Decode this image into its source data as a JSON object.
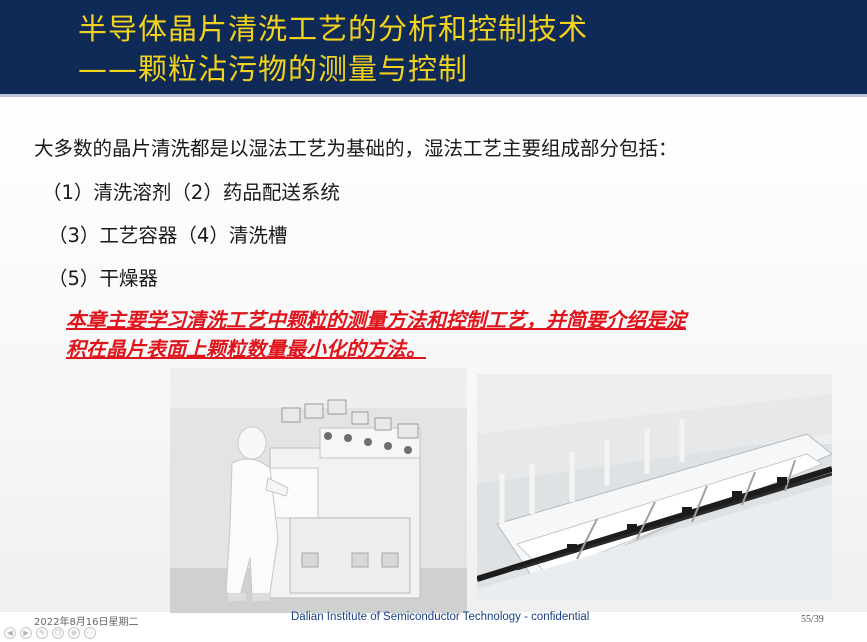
{
  "slide": {
    "title_line1": "半导体晶片清洗工艺的分析和控制技术",
    "title_line2": "——颗粒沾污物的测量与控制"
  },
  "body": {
    "intro": "大多数的晶片清洗都是以湿法工艺为基础的，湿法工艺主要组成部分包括：",
    "item_line1": "（1）清洗溶剂（2）药品配送系统",
    "item_line2": "（3）工艺容器（4）清洗槽",
    "item_line3": "（5）干燥器",
    "highlight_line1": "本章主要学习清洗工艺中颗粒的测量方法和控制工艺，并简要介绍是淀",
    "highlight_line2": "积在晶片表面上颗粒数量最小化的方法。"
  },
  "footer": {
    "date": "2022年8月16日星期二",
    "center": "Dalian Institute of Semiconductor Technology - confidential",
    "page": "55/39"
  },
  "nav": {
    "icons": [
      "prev-arrow-icon",
      "next-arrow-icon",
      "edit-icon",
      "copy-icon",
      "zoom-icon",
      "menu-icon"
    ]
  },
  "colors": {
    "header_bg": "#0f2a57",
    "title_text": "#f2d21b",
    "highlight_text": "#e0141b",
    "footer_center_text": "#1a3f8a"
  }
}
